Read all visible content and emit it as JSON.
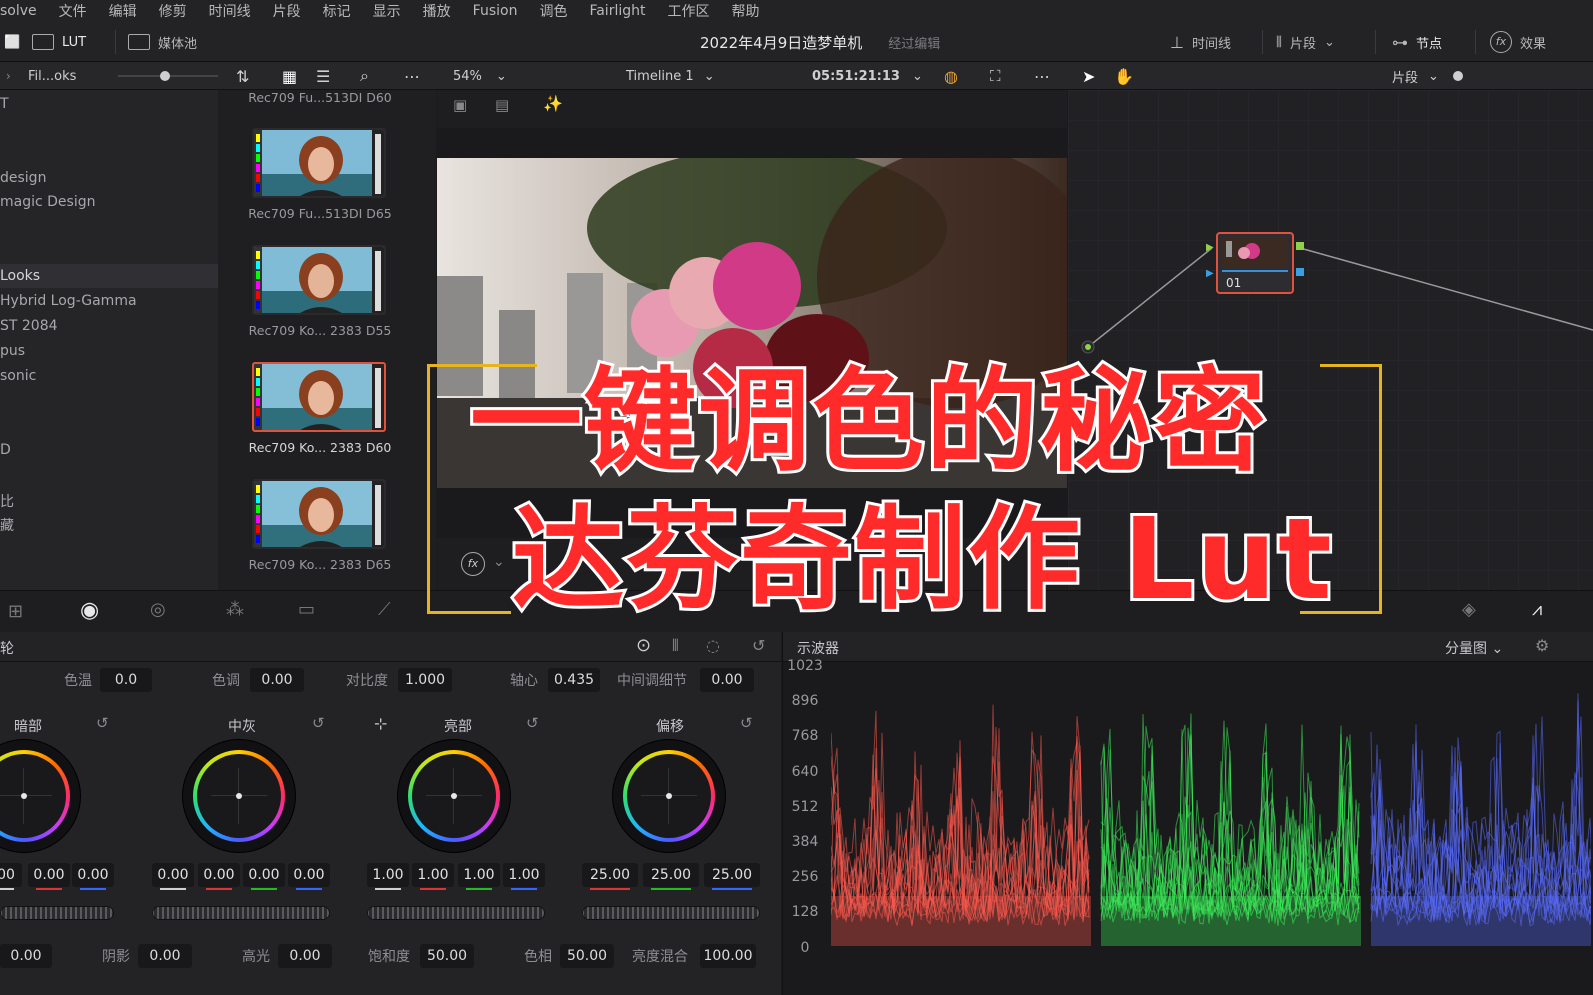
{
  "menubar": [
    "solve",
    "文件",
    "编辑",
    "修剪",
    "时间线",
    "片段",
    "标记",
    "显示",
    "播放",
    "Fusion",
    "调色",
    "Fairlight",
    "工作区",
    "帮助"
  ],
  "toolbar": {
    "lut_label": "LUT",
    "media_pool_label": "媒体池",
    "project_title": "2022年4月9日造梦单机",
    "project_status": "经过编辑",
    "timeline_label": "时间线",
    "clips_label": "片段",
    "nodes_label": "节点",
    "effects_label": "效果"
  },
  "subbar": {
    "browser_name": "Fil...oks",
    "zoom": "54%",
    "timeline_name": "Timeline 1",
    "timecode": "05:51:21:13",
    "clip_mode": "片段"
  },
  "lut_tree": [
    "T",
    "design",
    "magic Design",
    "Looks",
    "Hybrid Log-Gamma",
    "ST 2084",
    "pus",
    "sonic",
    "D",
    "比",
    "藏"
  ],
  "lut_thumbs": [
    {
      "label": "Rec709 Fu...513DI D60",
      "selected": false
    },
    {
      "label": "Rec709 Fu...513DI D65",
      "selected": false
    },
    {
      "label": "Rec709 Ko... 2383 D55",
      "selected": false
    },
    {
      "label": "Rec709 Ko... 2383 D60",
      "selected": true
    },
    {
      "label": "Rec709 Ko... 2383 D65",
      "selected": false
    }
  ],
  "node": {
    "label": "01"
  },
  "wheels": {
    "top_params": [
      {
        "label": "色温",
        "value": "0.0"
      },
      {
        "label": "色调",
        "value": "0.00"
      },
      {
        "label": "对比度",
        "value": "1.000"
      },
      {
        "label": "轴心",
        "value": "0.435"
      },
      {
        "label": "中间调细节",
        "value": "0.00"
      }
    ],
    "panel_title": "轮",
    "groups": [
      {
        "title": "暗部",
        "values": [
          "00",
          "0.00",
          "0.00"
        ]
      },
      {
        "title": "中灰",
        "values": [
          "0.00",
          "0.00",
          "0.00",
          "0.00"
        ]
      },
      {
        "title": "亮部",
        "values": [
          "1.00",
          "1.00",
          "1.00",
          "1.00"
        ]
      },
      {
        "title": "偏移",
        "values": [
          "25.00",
          "25.00",
          "25.00"
        ]
      }
    ],
    "bottom_params": [
      {
        "label": "",
        "value": "0.00"
      },
      {
        "label": "阴影",
        "value": "0.00"
      },
      {
        "label": "高光",
        "value": "0.00"
      },
      {
        "label": "饱和度",
        "value": "50.00"
      },
      {
        "label": "色相",
        "value": "50.00"
      },
      {
        "label": "亮度混合",
        "value": "100.00"
      }
    ]
  },
  "scope": {
    "title": "示波器",
    "mode": "分量图",
    "ticks": [
      "1023",
      "896",
      "768",
      "640",
      "512",
      "384",
      "256",
      "128",
      "0"
    ]
  },
  "overlay": {
    "line1": "一键调色的秘密",
    "line2": "达芬奇制作 Lut"
  },
  "colors": {
    "overlay_text": "#ff2a2a",
    "overlay_frame": "#e6b41e",
    "selected": "#e0523e"
  }
}
